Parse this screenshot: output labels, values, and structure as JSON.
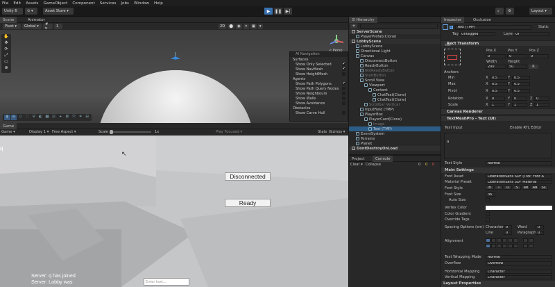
{
  "menu": [
    "File",
    "Edit",
    "Assets",
    "GameObject",
    "Component",
    "Services",
    "Jobs",
    "Window",
    "Help"
  ],
  "toolbar": {
    "account": "Unity 6",
    "cloud": "⊙ ▾",
    "store": "Asset Store ▾",
    "search": "⌕",
    "layers": "⚙",
    "layout": "Layout ▾"
  },
  "scene": {
    "tabs": [
      "Scene",
      "Animator"
    ],
    "toolbar": [
      "Pivot ▾",
      "Global ▾",
      "# ▾",
      "1"
    ],
    "right_controls": [
      "2D",
      "⬤",
      "◉",
      "✦",
      "▣",
      "▾"
    ],
    "persp": "< Persp",
    "tools": [
      "✋",
      "✥",
      "⟳",
      "⤢",
      "▭",
      "⊕"
    ],
    "bottom_tools": [
      "▮",
      "⊞",
      "◇",
      "⛶",
      "⚲",
      "◐",
      "▦",
      "⊡",
      "⌖",
      "⊠",
      "⤧",
      "⌗",
      "⊟"
    ]
  },
  "ai_nav": {
    "title": "AI Navigation",
    "sections": [
      {
        "name": "Surfaces",
        "items": [
          {
            "label": "Show Only Selected",
            "checked": true
          },
          {
            "label": "Show NavMesh",
            "checked": true
          },
          {
            "label": "Show HeightMesh",
            "checked": false
          }
        ]
      },
      {
        "name": "Agents",
        "items": [
          {
            "label": "Show Path Polygons",
            "checked": true
          },
          {
            "label": "Show Path Query Nodes",
            "checked": false
          },
          {
            "label": "Show Neighbours",
            "checked": false
          },
          {
            "label": "Show Walls",
            "checked": false
          },
          {
            "label": "Show Avoidance",
            "checked": false
          }
        ]
      },
      {
        "name": "Obstacles",
        "items": [
          {
            "label": "Show Carve Hull",
            "checked": false
          }
        ]
      }
    ]
  },
  "game": {
    "tab": "Game",
    "toolbar": {
      "mode": "Game ▾",
      "display": "Display 1 ▾",
      "aspect": "Free Aspect ▾",
      "scale_label": "Scale",
      "scale_value": "1x",
      "play_focused": "Play Focused ▾",
      "stats": "Stats",
      "gizmos": "Gizmos ▾"
    },
    "q": "q",
    "disconnected": "Disconnected",
    "ready": "Ready",
    "log": [
      "Server: q has joined",
      "Server: Lobby was"
    ],
    "input_placeholder": "Enter text..."
  },
  "hierarchy": {
    "tab": "Hierarchy",
    "items": [
      {
        "label": "ServerScene",
        "depth": 0,
        "bold": true
      },
      {
        "label": "PlayerPrefab(Clone)",
        "depth": 1
      },
      {
        "label": "LobbyScene",
        "depth": 0,
        "bold": true
      },
      {
        "label": "LobbyScene",
        "depth": 1
      },
      {
        "label": "Directional Light",
        "depth": 1
      },
      {
        "label": "Canvas",
        "depth": 1
      },
      {
        "label": "DisconnectButton",
        "depth": 2
      },
      {
        "label": "ReadyButton",
        "depth": 2
      },
      {
        "label": "NotReadyButton",
        "depth": 2,
        "dim": true
      },
      {
        "label": "StartButton",
        "depth": 2,
        "dim": true
      },
      {
        "label": "Scroll View",
        "depth": 2
      },
      {
        "label": "Viewport",
        "depth": 3
      },
      {
        "label": "Content",
        "depth": 4
      },
      {
        "label": "ChatText(Clone)",
        "depth": 5
      },
      {
        "label": "ChatText(Clone)",
        "depth": 5
      },
      {
        "label": "Scrollbar Vertical",
        "depth": 3,
        "dim": true
      },
      {
        "label": "InputField (TMP)",
        "depth": 2
      },
      {
        "label": "PlayerBox",
        "depth": 2
      },
      {
        "label": "PlayerCard(Clone)",
        "depth": 3
      },
      {
        "label": "Image",
        "depth": 4,
        "dim": true
      },
      {
        "label": "Text (TMP)",
        "depth": 4,
        "selected": true
      },
      {
        "label": "EventSystem",
        "depth": 1
      },
      {
        "label": "Terrains",
        "depth": 1
      },
      {
        "label": "Planet",
        "depth": 1
      },
      {
        "label": "DontDestroyOnLoad",
        "depth": 0,
        "bold": true
      }
    ]
  },
  "project": {
    "tabs": [
      "Project",
      "Console"
    ],
    "clear": "Clear ▾",
    "collapse": "Collapse",
    "counts": [
      "0",
      "0",
      "0"
    ]
  },
  "inspector": {
    "tabs": [
      "Inspector",
      "Occlusion"
    ],
    "object_name": "Text (TMP)",
    "static": "Static",
    "tag_label": "Tag",
    "tag": "Untagged",
    "layer_label": "Layer",
    "layer": "UI",
    "rect_transform": "Rect Transform",
    "stretch": "left",
    "pos_headers": [
      "Pos X",
      "Pos Y",
      "Pos Z"
    ],
    "pos_values": [
      "0",
      "0",
      "0"
    ],
    "size_headers": [
      "Width",
      "Height"
    ],
    "size_values": [
      "200",
      "50"
    ],
    "anchors": "Anchors",
    "min_label": "Min",
    "min": [
      "X",
      "0.5",
      "Y",
      "0.5"
    ],
    "max_label": "Max",
    "max": [
      "X",
      "0.5",
      "Y",
      "0.5"
    ],
    "pivot_label": "Pivot",
    "pivot": [
      "X",
      "0.5",
      "Y",
      "0.5"
    ],
    "rotation_label": "Rotation",
    "rotation": [
      "X",
      "0",
      "Y",
      "0",
      "Z",
      "0"
    ],
    "scale_label": "Scale",
    "scale": [
      "X",
      "1",
      "Y",
      "1",
      "Z",
      "1"
    ],
    "canvas_renderer": "Canvas Renderer",
    "tmp": "TextMeshPro - Text (UI)",
    "text_input": "Text Input",
    "enable_rtl": "Enable RTL Editor",
    "text_value": "a",
    "text_style_label": "Text Style",
    "text_style": "Normal",
    "main_settings": "Main Settings",
    "font_asset_label": "Font Asset",
    "font_asset": "LiberationSans SDF (TMP_Font A",
    "material_label": "Material Preset",
    "material": "LiberationSans SDF Material",
    "font_style_label": "Font Style",
    "font_style": [
      "B",
      "I",
      "U",
      "S",
      "ab",
      "AB",
      "SC"
    ],
    "font_size_label": "Font Size",
    "font_size": "36",
    "auto_size_label": "Auto Size",
    "vertex_color_label": "Vertex Color",
    "color_gradient_label": "Color Gradient",
    "override_tags_label": "Override Tags",
    "spacing_label": "Spacing Options (em)",
    "spacing": [
      {
        "label": "Character",
        "value": "0"
      },
      {
        "label": "Word",
        "value": "0"
      },
      {
        "label": "Line",
        "value": "0"
      },
      {
        "label": "Paragraph",
        "value": "0"
      }
    ],
    "alignment_label": "Alignment",
    "wrapping_label": "Text Wrapping Mode",
    "wrapping": "Normal",
    "overflow_label": "Overflow",
    "overflow": "Overflow",
    "hmap_label": "Horizontal Mapping",
    "hmap": "Character",
    "vmap_label": "Vertical Mapping",
    "vmap": "Character",
    "layout_props": "Layout Properties"
  },
  "colors": {
    "selected": "#2c5d87",
    "accent": "#3a72b0",
    "vertex": "#ffffff"
  }
}
